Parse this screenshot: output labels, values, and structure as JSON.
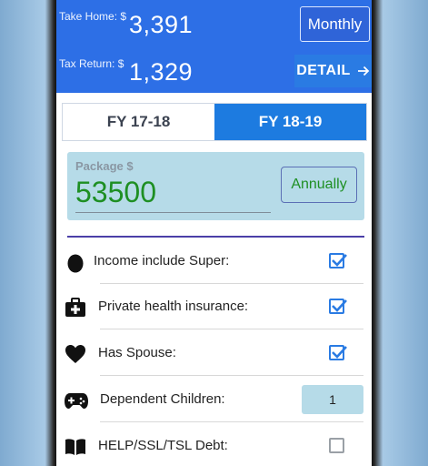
{
  "header": {
    "take_home_label": "Take Home: $",
    "take_home_value": "3,391",
    "tax_return_label": "Tax Return: $",
    "tax_return_value": "1,329",
    "period_button": "Monthly",
    "detail_button": "DETAIL",
    "detail_icon": "arrow-right-icon"
  },
  "tabs": [
    {
      "label": "FY 17-18",
      "selected": false
    },
    {
      "label": "FY 18-19",
      "selected": true
    }
  ],
  "package": {
    "label": "Package $",
    "value": "53500",
    "period_button": "Annually"
  },
  "options": [
    {
      "icon": "egg-icon",
      "label": "Income include Super:",
      "control": "checkbox",
      "checked": true
    },
    {
      "icon": "first-aid-kit-icon",
      "label": "Private health insurance:",
      "control": "checkbox",
      "checked": true
    },
    {
      "icon": "heart-icon",
      "label": "Has Spouse:",
      "control": "checkbox",
      "checked": true
    },
    {
      "icon": "gamepad-icon",
      "label": "Dependent Children:",
      "control": "number",
      "value": "1"
    },
    {
      "icon": "book-icon",
      "label": "HELP/SSL/TSL Debt:",
      "control": "checkbox",
      "checked": false
    }
  ],
  "colors": {
    "header_bg": "#2d6fe6",
    "tab_selected": "#1d7be0",
    "package_bg": "#b6dbe8",
    "package_text": "#1e8f23",
    "checkbox": "#2a7be3",
    "divider": "#4b3fa8"
  }
}
